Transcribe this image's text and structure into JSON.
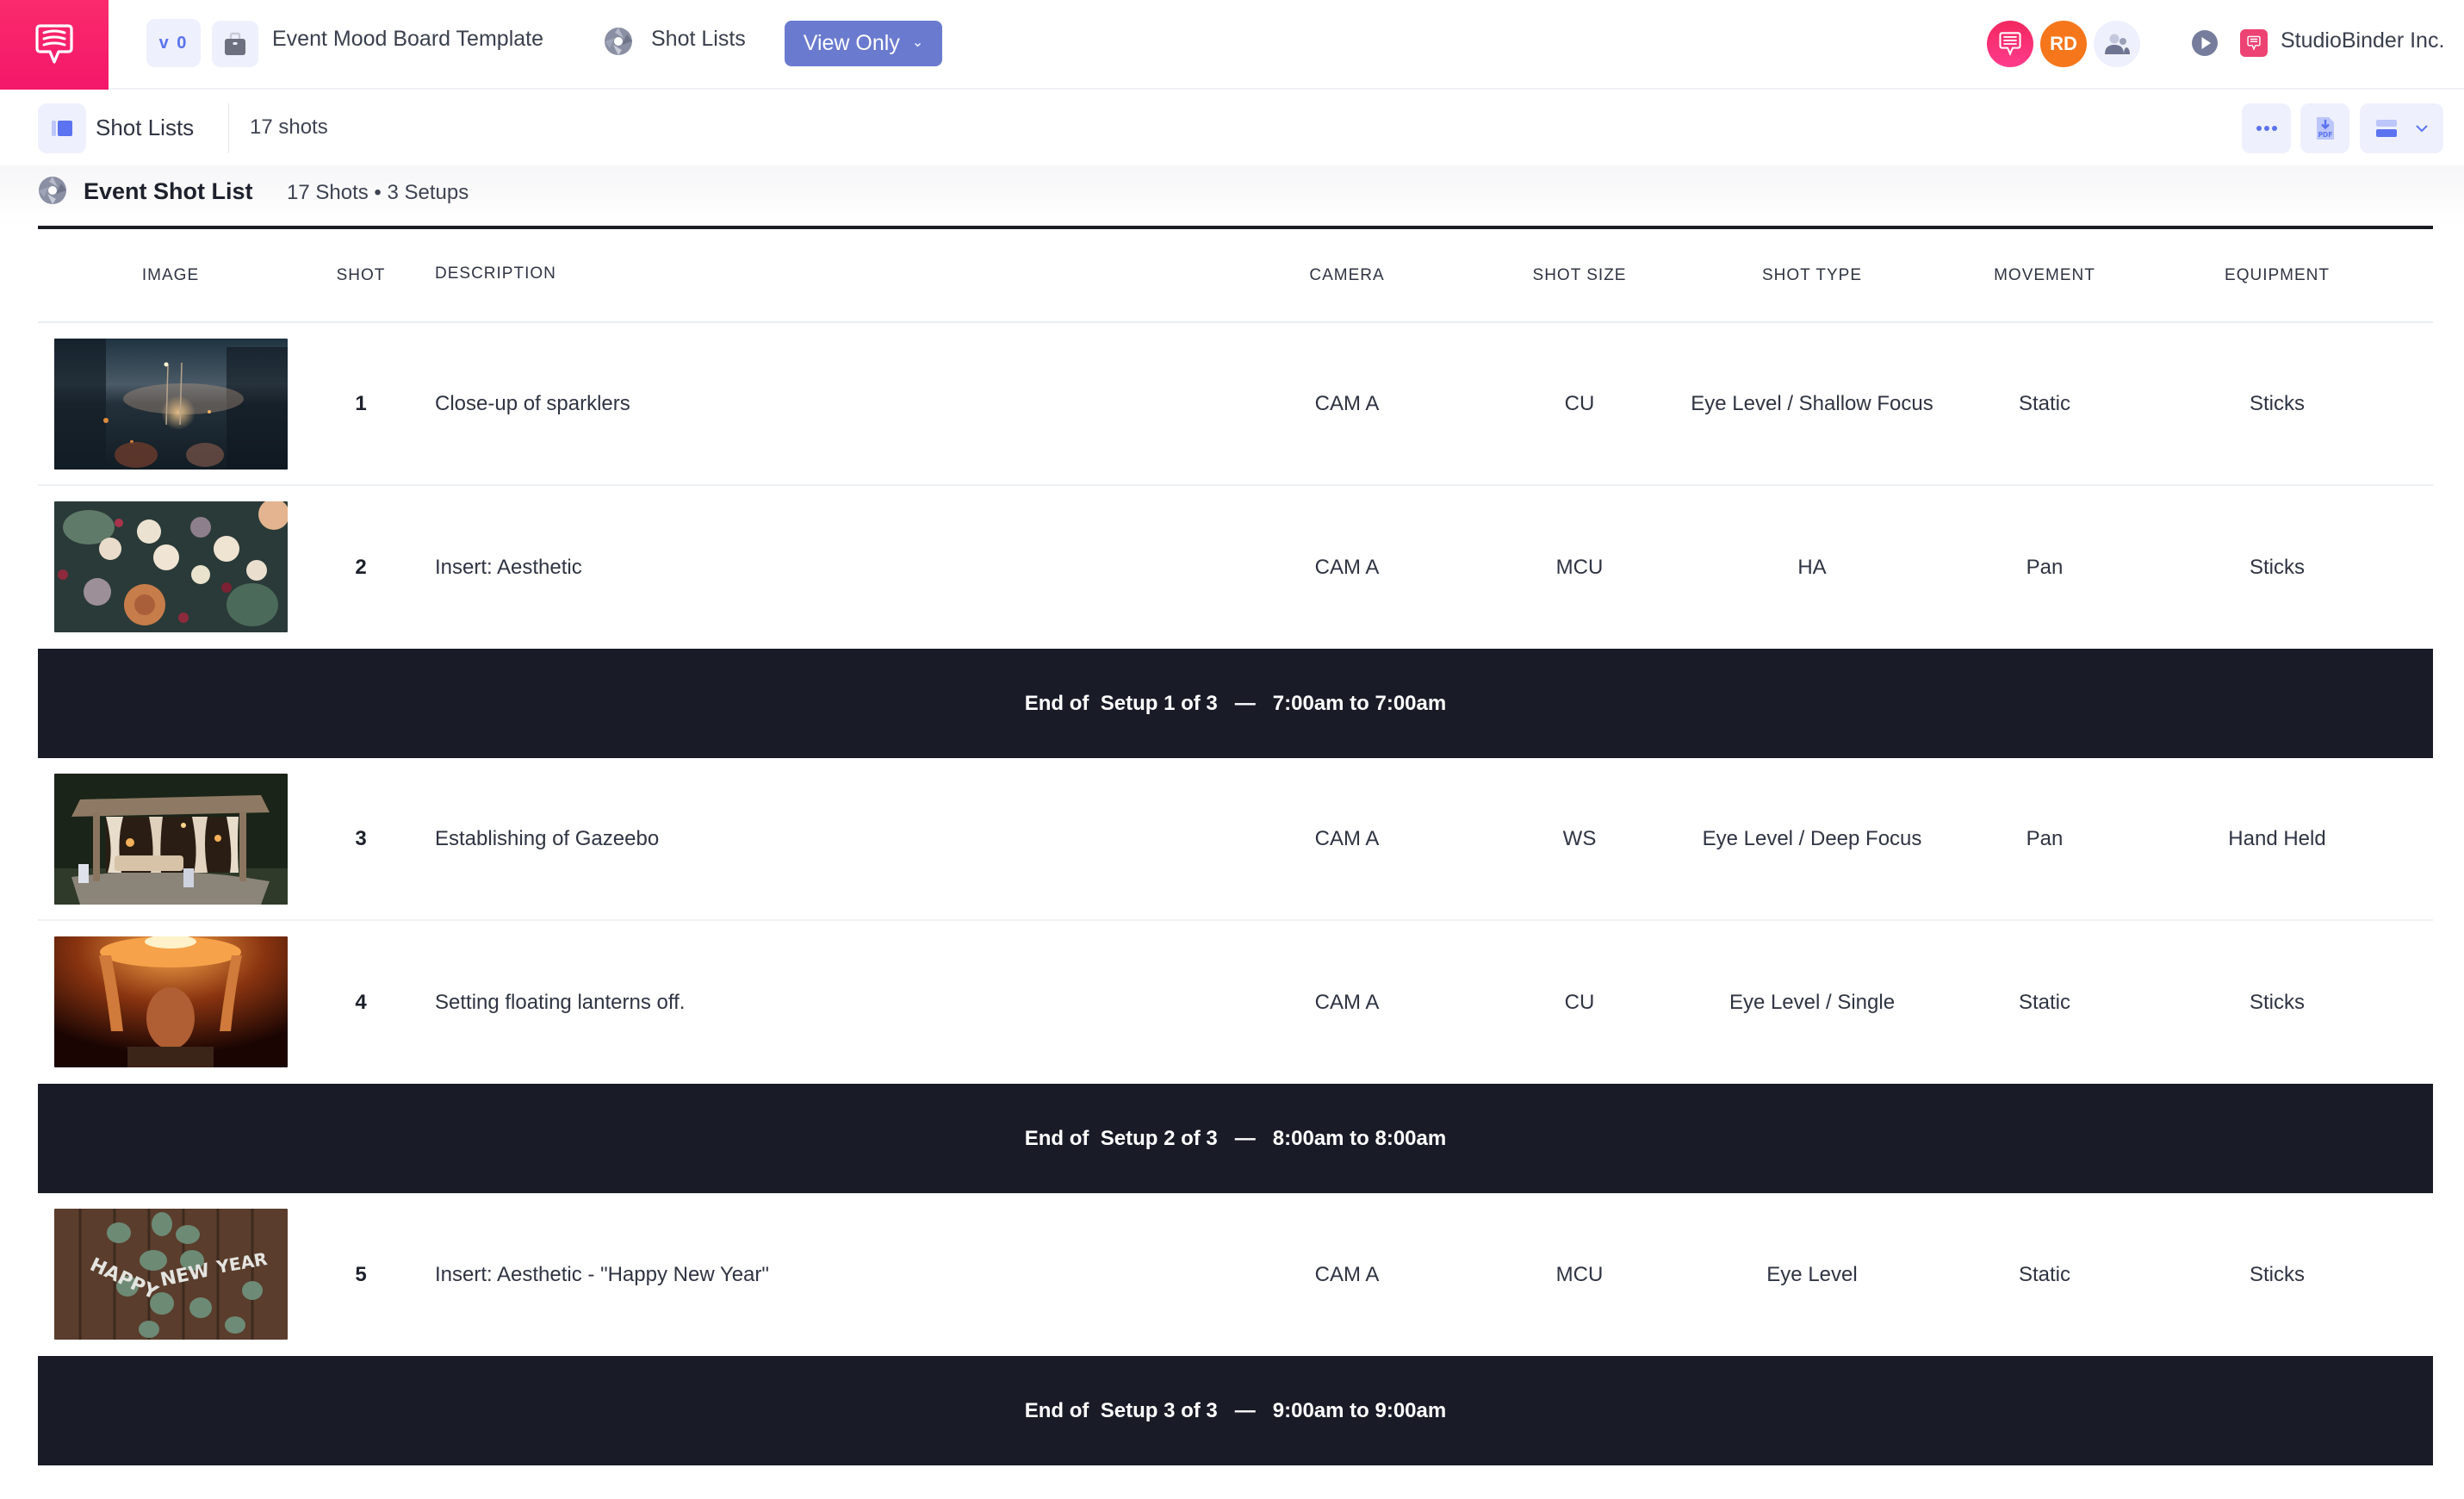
{
  "topbar": {
    "version": "v 0",
    "project_title": "Event Mood Board Template",
    "section_label": "Shot Lists",
    "view_mode": "View Only",
    "avatars": [
      {
        "type": "logo",
        "label": ""
      },
      {
        "type": "initials",
        "label": "RD"
      },
      {
        "type": "team",
        "label": ""
      }
    ],
    "org_name": "StudioBinder Inc."
  },
  "subbar": {
    "title": "Shot Lists",
    "count": "17 shots",
    "tools": [
      "more-options",
      "export-pdf",
      "layout-view"
    ]
  },
  "section": {
    "title": "Event Shot List",
    "summary": "17 Shots • 3 Setups"
  },
  "table": {
    "columns": [
      "IMAGE",
      "SHOT",
      "DESCRIPTION",
      "CAMERA",
      "SHOT SIZE",
      "SHOT TYPE",
      "MOVEMENT",
      "EQUIPMENT"
    ],
    "shots": [
      {
        "shot": "1",
        "image": "sparklers",
        "description": "Close-up of sparklers",
        "camera": "CAM A",
        "shot_size": "CU",
        "shot_type": "Eye Level / Shallow Focus",
        "movement": "Static",
        "equipment": "Sticks"
      },
      {
        "shot": "2",
        "image": "flowers",
        "description": "Insert: Aesthetic",
        "camera": "CAM A",
        "shot_size": "MCU",
        "shot_type": "HA",
        "movement": "Pan",
        "equipment": "Sticks"
      },
      {
        "shot": "3",
        "image": "gazebo",
        "description": "Establishing of Gazeebo",
        "camera": "CAM A",
        "shot_size": "WS",
        "shot_type": "Eye Level / Deep Focus",
        "movement": "Pan",
        "equipment": "Hand Held"
      },
      {
        "shot": "4",
        "image": "lantern",
        "description": "Setting floating lanterns off.",
        "camera": "CAM A",
        "shot_size": "CU",
        "shot_type": "Eye Level / Single",
        "movement": "Static",
        "equipment": "Sticks"
      },
      {
        "shot": "5",
        "image": "happy-new-year",
        "description": "Insert: Aesthetic - \"Happy New Year\"",
        "camera": "CAM A",
        "shot_size": "MCU",
        "shot_type": "Eye Level",
        "movement": "Static",
        "equipment": "Sticks"
      }
    ],
    "setups": [
      {
        "label": "End of  Setup 1 of 3   —   7:00am to 7:00am"
      },
      {
        "label": "End of  Setup 2 of 3   —   8:00am to 8:00am"
      },
      {
        "label": "End of  Setup 3 of 3   —   9:00am to 9:00am"
      }
    ]
  },
  "colors": {
    "brand_pink": "#f4176a",
    "accent_blue": "#5b73f0",
    "view_only_button": "#6a7bcf",
    "avatar_orange": "#f6761b",
    "setup_bar": "#191b27"
  }
}
